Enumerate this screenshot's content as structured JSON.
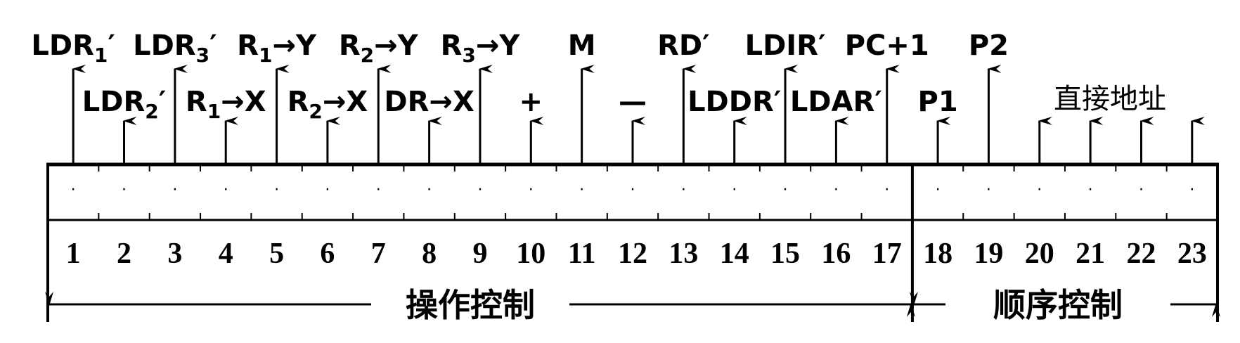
{
  "bit_count": 23,
  "operation_bits": 17,
  "signals": [
    {
      "bit": 1,
      "row": 1,
      "main": "LDR",
      "sub": "1",
      "suffix": "′"
    },
    {
      "bit": 2,
      "row": 2,
      "main": "LDR",
      "sub": "2",
      "suffix": "′"
    },
    {
      "bit": 3,
      "row": 1,
      "main": "LDR",
      "sub": "3",
      "suffix": "′"
    },
    {
      "bit": 4,
      "row": 2,
      "main": "R",
      "sub": "1",
      "suffix": "→X"
    },
    {
      "bit": 5,
      "row": 1,
      "main": "R",
      "sub": "1",
      "suffix": "→Y"
    },
    {
      "bit": 6,
      "row": 2,
      "main": "R",
      "sub": "2",
      "suffix": "→X"
    },
    {
      "bit": 7,
      "row": 1,
      "main": "R",
      "sub": "2",
      "suffix": "→Y"
    },
    {
      "bit": 8,
      "row": 2,
      "main": "DR→X",
      "sub": "",
      "suffix": ""
    },
    {
      "bit": 9,
      "row": 1,
      "main": "R",
      "sub": "3",
      "suffix": "→Y"
    },
    {
      "bit": 10,
      "row": 2,
      "main": "+",
      "sub": "",
      "suffix": ""
    },
    {
      "bit": 11,
      "row": 1,
      "main": "M",
      "sub": "",
      "suffix": ""
    },
    {
      "bit": 12,
      "row": 2,
      "main": "—",
      "sub": "",
      "suffix": ""
    },
    {
      "bit": 13,
      "row": 1,
      "main": "RD′",
      "sub": "",
      "suffix": ""
    },
    {
      "bit": 14,
      "row": 2,
      "main": "LDDR′",
      "sub": "",
      "suffix": ""
    },
    {
      "bit": 15,
      "row": 1,
      "main": "LDIR′",
      "sub": "",
      "suffix": ""
    },
    {
      "bit": 16,
      "row": 2,
      "main": "LDAR′",
      "sub": "",
      "suffix": ""
    },
    {
      "bit": 17,
      "row": 1,
      "main": "PC+1",
      "sub": "",
      "suffix": ""
    },
    {
      "bit": 18,
      "row": 2,
      "main": "P1",
      "sub": "",
      "suffix": ""
    },
    {
      "bit": 19,
      "row": 1,
      "main": "P2",
      "sub": "",
      "suffix": ""
    },
    {
      "bit": 20,
      "row": 2,
      "main": "",
      "sub": "",
      "suffix": ""
    },
    {
      "bit": 21,
      "row": 2,
      "main": "",
      "sub": "",
      "suffix": ""
    },
    {
      "bit": 22,
      "row": 2,
      "main": "",
      "sub": "",
      "suffix": ""
    },
    {
      "bit": 23,
      "row": 2,
      "main": "",
      "sub": "",
      "suffix": ""
    }
  ],
  "direct_address_label": "直接地址",
  "bit_numbers": [
    "1",
    "2",
    "3",
    "4",
    "5",
    "6",
    "7",
    "8",
    "9",
    "10",
    "11",
    "12",
    "13",
    "14",
    "15",
    "16",
    "17",
    "18",
    "19",
    "20",
    "21",
    "22",
    "23"
  ],
  "cell_marker": "·",
  "sections": {
    "operation_control": "操作控制",
    "sequence_control": "顺序控制"
  }
}
